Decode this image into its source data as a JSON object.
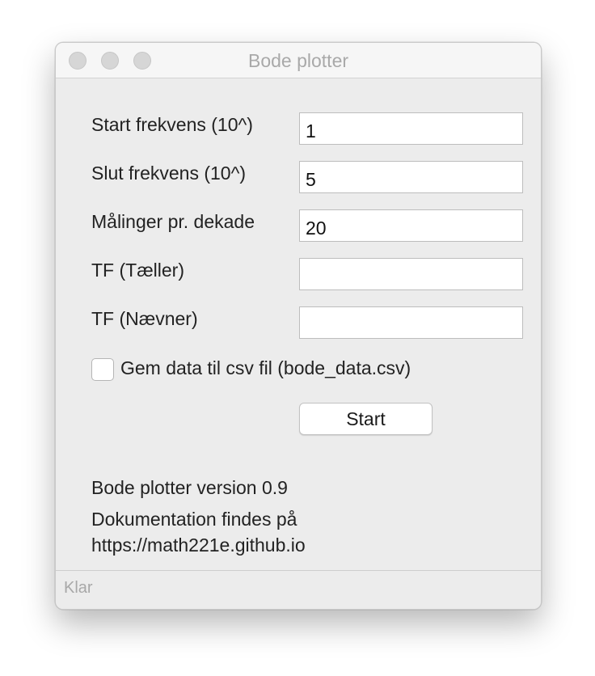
{
  "window": {
    "title": "Bode plotter"
  },
  "form": {
    "start_label": "Start frekvens (10^)",
    "start_value": "1",
    "end_label": "Slut frekvens (10^)",
    "end_value": "5",
    "per_decade_label": "Målinger pr. dekade",
    "per_decade_value": "20",
    "numerator_label": "TF (Tæller)",
    "numerator_value": "",
    "denominator_label": "TF (Nævner)",
    "denominator_value": "",
    "save_csv_label": "Gem data til csv fil (bode_data.csv)",
    "save_csv_checked": false,
    "start_button": "Start"
  },
  "info": {
    "version": "Bode plotter version 0.9",
    "docs_line1": "Dokumentation findes på",
    "docs_line2": "https://math221e.github.io"
  },
  "status": {
    "text": "Klar"
  },
  "colors": {
    "window_bg": "#ececec",
    "titlebar_bg": "#f6f6f6",
    "traffic_light_inactive": "#d6d6d6",
    "title_text": "#a9a9a9",
    "status_text": "#a8a8a8"
  },
  "icons": {
    "close": "close-icon",
    "minimize": "minimize-icon",
    "maximize": "maximize-icon"
  }
}
